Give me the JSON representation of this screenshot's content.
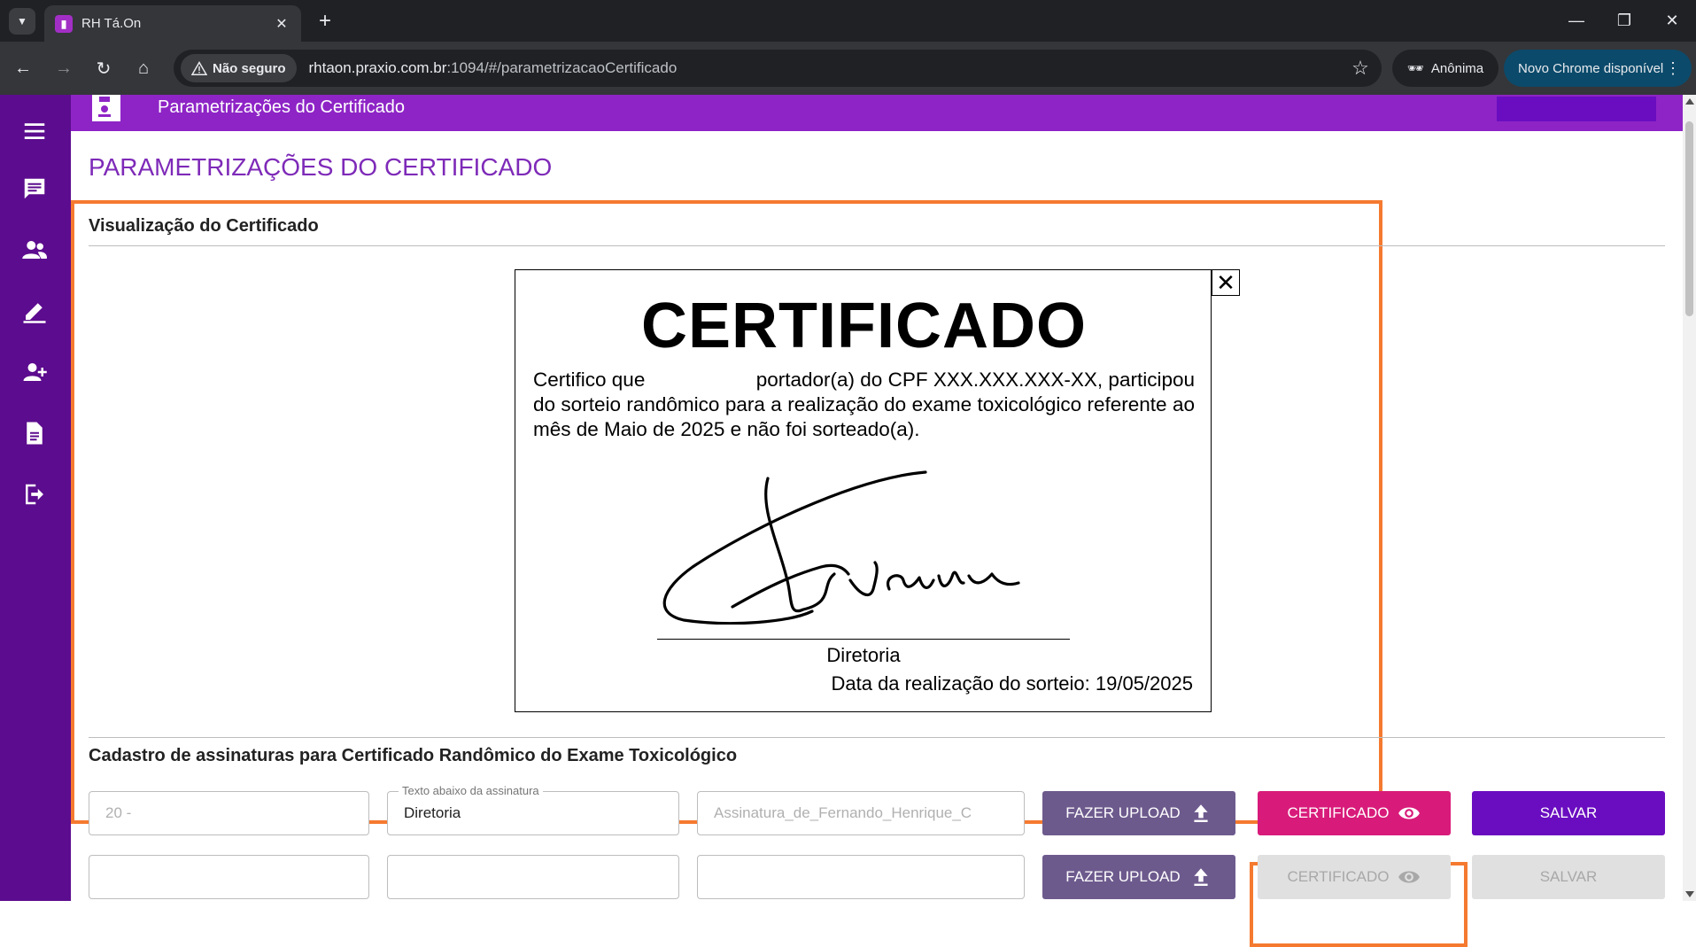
{
  "browser": {
    "tab_title": "RH Tá.On",
    "security_label": "Não seguro",
    "url_host": "rhtaon.praxio.com.br",
    "url_path": ":1094/#/parametrizacaoCertificado",
    "incognito_label": "Anônima",
    "update_label": "Novo Chrome disponível"
  },
  "appbar": {
    "title": "Parametrizações do Certificado"
  },
  "sidebar": {
    "items": [
      "menu-icon",
      "chat-icon",
      "users-icon",
      "edit-icon",
      "add-user-icon",
      "document-icon",
      "logout-icon"
    ]
  },
  "page": {
    "title": "PARAMETRIZAÇÕES DO CERTIFICADO",
    "preview_section_title": "Visualização do Certificado",
    "form_section_title": "Cadastro de assinaturas para Certificado Randômico do Exame Toxicológico"
  },
  "certificate": {
    "heading": "CERTIFICADO",
    "body": "Certifico que                    portador(a) do CPF XXX.XXX.XXX-XX, participou do sorteio randômico para a realização do exame toxicológico referente ao mês de Maio de 2025 e não foi sorteado(a).",
    "signer_role": "Diretoria",
    "date_text": "Data da realização do sorteio: 19/05/2025",
    "close_label": "✕"
  },
  "form": {
    "rows": [
      {
        "order_value": "20 -",
        "caption_label": "Texto abaixo da assinatura",
        "caption_value": "Diretoria",
        "file_value": "Assinatura_de_Fernando_Henrique_C",
        "upload_label": "FAZER UPLOAD",
        "cert_label": "CERTIFICADO",
        "save_label": "SALVAR"
      },
      {
        "order_value": "",
        "caption_value": "",
        "file_value": "",
        "upload_label": "FAZER UPLOAD",
        "cert_label": "CERTIFICADO",
        "save_label": "SALVAR"
      }
    ]
  },
  "colors": {
    "sidebar": "#5c0c8e",
    "appbar": "#8e24c6",
    "title": "#7e2ab8",
    "highlight": "#f57a30",
    "certificate_button": "#d81b7a",
    "save_button": "#6a0dc0",
    "upload_button": "#6d5a8d"
  }
}
